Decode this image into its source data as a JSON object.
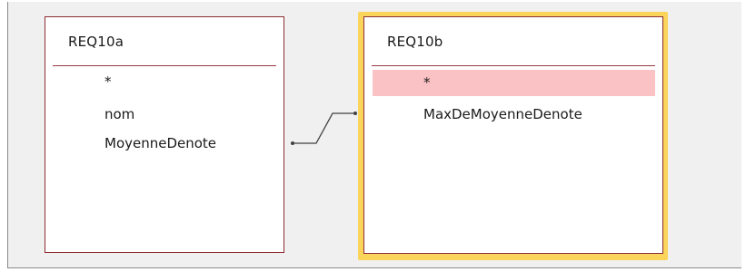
{
  "tables": [
    {
      "title": "REQ10a",
      "fields": [
        "*",
        "nom",
        "MoyenneDenote"
      ]
    },
    {
      "title": "REQ10b",
      "fields": [
        "*",
        "MaxDeMoyenneDenote"
      ],
      "selected": true,
      "selected_field_index": 0
    }
  ],
  "relationship": {
    "from_table": "REQ10a",
    "from_field": "MoyenneDenote",
    "to_table": "REQ10b",
    "to_field": "*"
  },
  "colors": {
    "canvas_bg": "#f0f0f0",
    "table_border": "#8c2f36",
    "selection_frame": "#fbd45c",
    "selected_row": "#fbc2c6",
    "connector": "#404040"
  }
}
